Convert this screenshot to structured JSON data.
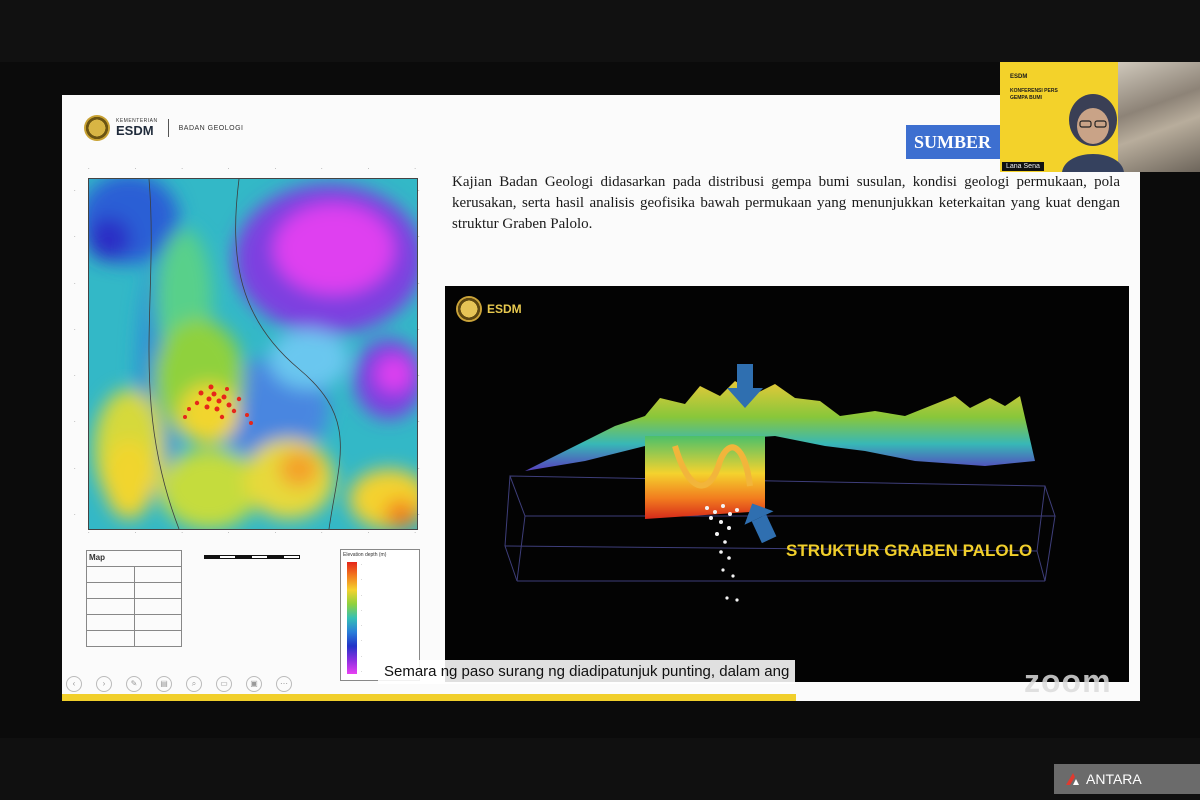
{
  "slide": {
    "header": {
      "ministry_small": "KEMENTERIAN",
      "logo_text": "ESDM",
      "agency": "BADAN GEOLOGI"
    },
    "sumber_label": "SUMBER",
    "paragraph": "Kajian Badan Geologi didasarkan pada distribusi gempa bumi susulan, kondisi geologi permukaan, pola kerusakan, serta hasil analisis geofisika bawah permukaan yang menunjukkan keterkaitan yang kuat dengan struktur Graben Palolo.",
    "map": {
      "info_title": "Map",
      "legend_title": "Elevation depth (m)",
      "colors": [
        "#e5261a",
        "#f4d22e",
        "#8fd13d",
        "#35c0b5",
        "#2a7fd9",
        "#8a2fe0",
        "#e840f2"
      ]
    },
    "panel3d": {
      "logo_text": "ESDM",
      "structure_label": "STRUKTUR GRABEN PALOLO"
    }
  },
  "caption": "Semara ng paso surang ng diadipatunjuk punting, dalam ang",
  "webcam": {
    "title_line1": "KONFERENSI PERS",
    "title_line2": "GEMPA BUMI",
    "logo_text": "ESDM",
    "participant_name": "Lana Sena"
  },
  "overlay": {
    "zoom_logo": "zoom",
    "antara_logo": "ANTARA"
  }
}
